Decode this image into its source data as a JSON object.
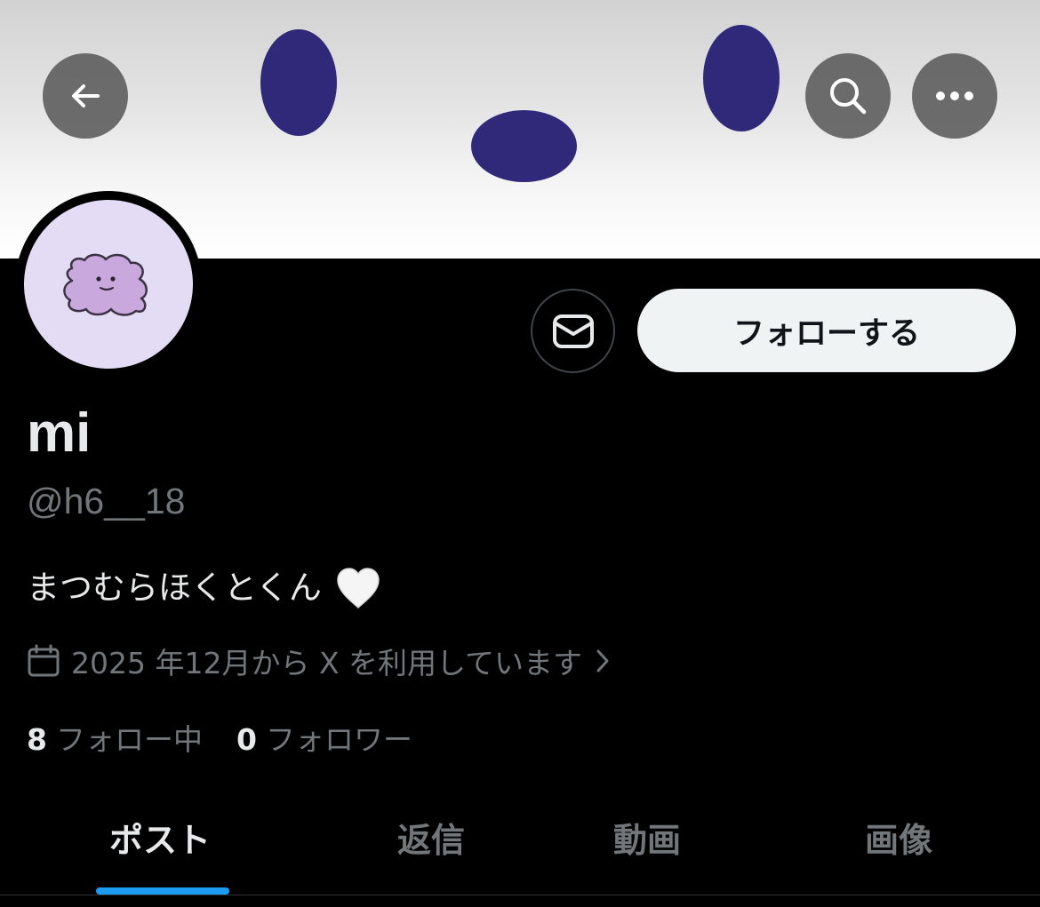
{
  "profile": {
    "name": "mi",
    "handle": "@h6__18",
    "bio": "まつむらほくとくん",
    "joined": "2025 年12月から X を利用しています",
    "following_count": "8",
    "following_label": "フォロー中",
    "followers_count": "0",
    "followers_label": "フォロワー"
  },
  "actions": {
    "follow_label": "フォローする"
  },
  "tabs": [
    {
      "label": "ポスト",
      "active": true
    },
    {
      "label": "返信",
      "active": false
    },
    {
      "label": "動画",
      "active": false
    },
    {
      "label": "画像",
      "active": false
    }
  ],
  "icons": {
    "back": "arrow-left-icon",
    "search": "search-icon",
    "more": "more-horizontal-icon",
    "message": "envelope-icon",
    "calendar": "calendar-icon",
    "chevron": "chevron-right-icon",
    "heart": "white-heart-icon"
  },
  "colors": {
    "background": "#000000",
    "accent": "#1d9bf0",
    "text_primary": "#e7e9ea",
    "text_secondary": "#71767b",
    "banner_blob": "#30297a",
    "avatar_bg": "#e4dcf5",
    "follow_button_bg": "#eff3f4"
  }
}
